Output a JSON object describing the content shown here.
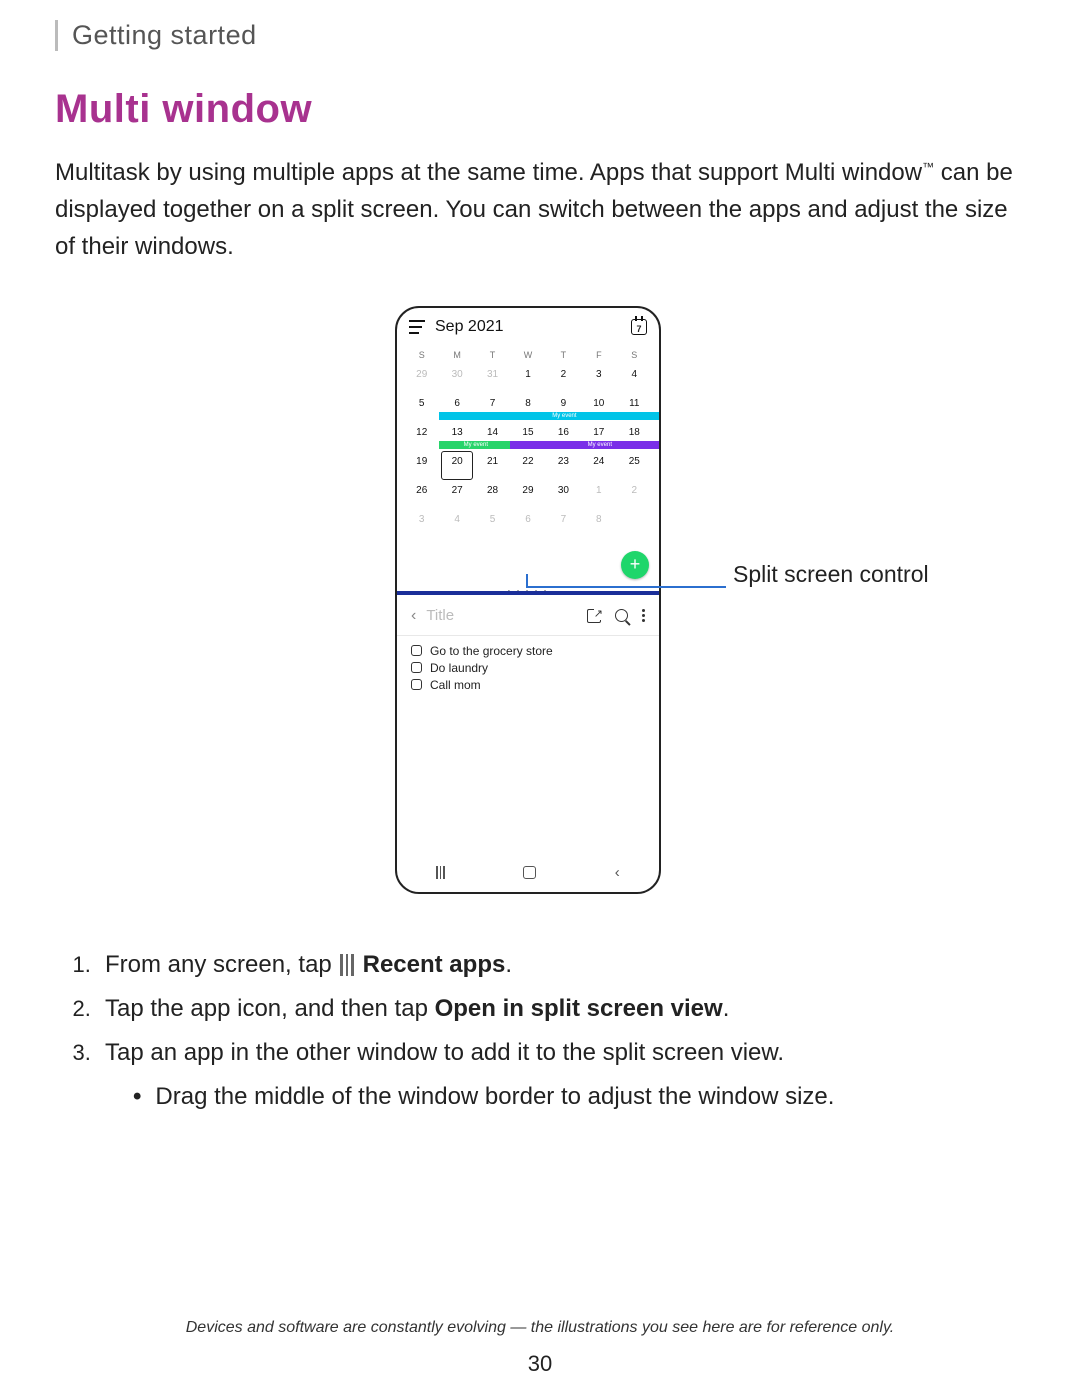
{
  "header": {
    "section": "Getting started"
  },
  "title": "Multi window",
  "tm": "™",
  "intro_a": "Multitask by using multiple apps at the same time. Apps that support Multi window",
  "intro_b": " can be displayed together on a split screen. You can switch between the apps and adjust the size of their windows.",
  "phone": {
    "month": "Sep 2021",
    "today_badge": "7",
    "dow": [
      "S",
      "M",
      "T",
      "W",
      "T",
      "F",
      "S"
    ],
    "rows": [
      {
        "cells": [
          {
            "n": "29",
            "gray": true
          },
          {
            "n": "30",
            "gray": true
          },
          {
            "n": "31",
            "gray": true
          },
          {
            "n": "1"
          },
          {
            "n": "2"
          },
          {
            "n": "3"
          },
          {
            "n": "4"
          }
        ]
      },
      {
        "cells": [
          {
            "n": "5"
          },
          {
            "n": "6"
          },
          {
            "n": "7"
          },
          {
            "n": "8"
          },
          {
            "n": "9"
          },
          {
            "n": "10"
          },
          {
            "n": "11"
          }
        ],
        "ev": {
          "label": "My event",
          "cls": "ev-cyan",
          "from": 1,
          "to": 7
        }
      },
      {
        "cells": [
          {
            "n": "12"
          },
          {
            "n": "13"
          },
          {
            "n": "14"
          },
          {
            "n": "15"
          },
          {
            "n": "16"
          },
          {
            "n": "17"
          },
          {
            "n": "18"
          }
        ],
        "ev2": [
          {
            "label": "My event",
            "cls": "ev-green",
            "from": 1,
            "to": 2
          },
          {
            "label": "My event",
            "cls": "ev-purple",
            "from": 3,
            "to": 7
          }
        ]
      },
      {
        "cells": [
          {
            "n": "19"
          },
          {
            "n": "20",
            "sel": true
          },
          {
            "n": "21"
          },
          {
            "n": "22"
          },
          {
            "n": "23"
          },
          {
            "n": "24"
          },
          {
            "n": "25"
          }
        ]
      },
      {
        "cells": [
          {
            "n": "26"
          },
          {
            "n": "27"
          },
          {
            "n": "28"
          },
          {
            "n": "29"
          },
          {
            "n": "30"
          },
          {
            "n": "1",
            "gray": true
          },
          {
            "n": "2",
            "gray": true
          }
        ]
      },
      {
        "cells": [
          {
            "n": "3",
            "gray": true
          },
          {
            "n": "4",
            "gray": true
          },
          {
            "n": "5",
            "gray": true
          },
          {
            "n": "6",
            "gray": true
          },
          {
            "n": "7",
            "gray": true
          },
          {
            "n": "8",
            "gray": true
          },
          {
            "n": "",
            "gray": true
          }
        ]
      }
    ],
    "notes_title": "Title",
    "checklist": [
      "Go to the grocery store",
      "Do laundry",
      "Call mom"
    ]
  },
  "callout": "Split screen control",
  "steps": {
    "s1_a": "From any screen, tap ",
    "s1_b": "Recent apps",
    "s1_c": ".",
    "s2_a": "Tap the app icon, and then tap ",
    "s2_b": "Open in split screen view",
    "s2_c": ".",
    "s3": "Tap an app in the other window to add it to the split screen view.",
    "s3sub": "Drag the middle of the window border to adjust the window size."
  },
  "footer": "Devices and software are constantly evolving — the illustrations you see here are for reference only.",
  "page_number": "30"
}
